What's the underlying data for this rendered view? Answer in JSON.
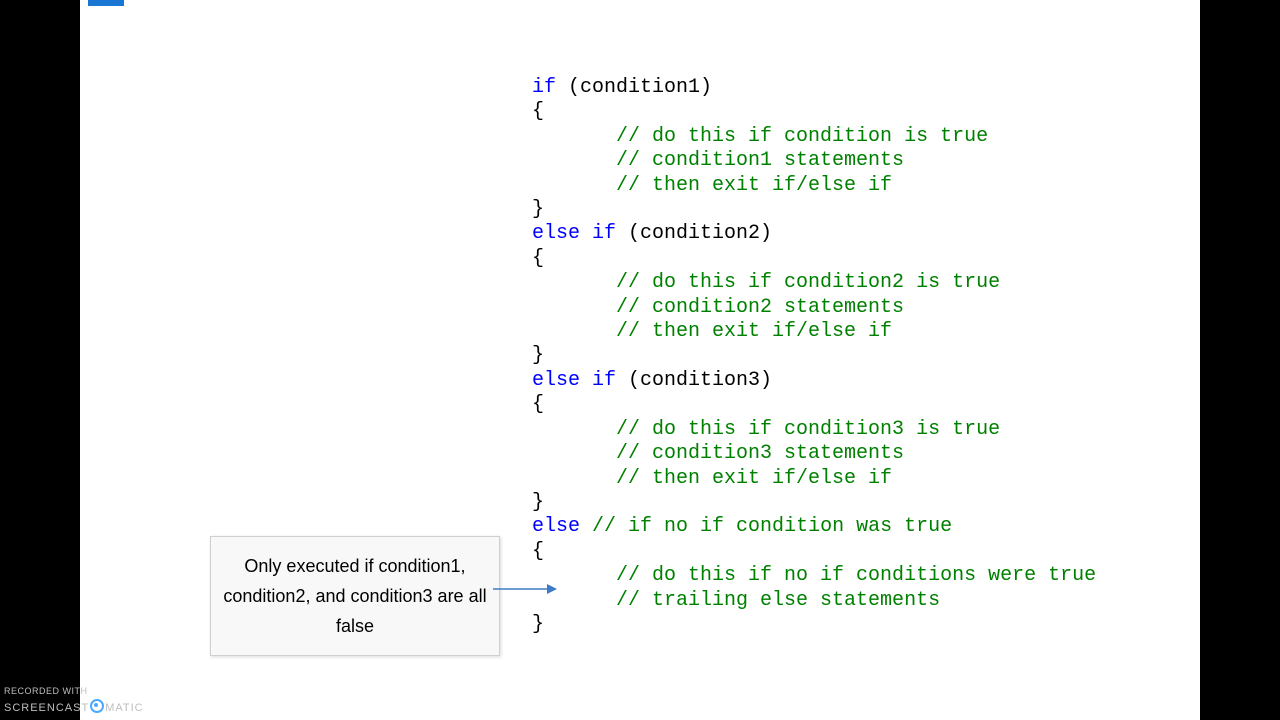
{
  "code": {
    "blocks": [
      {
        "head": [
          {
            "t": "if",
            "c": "kw"
          },
          {
            "t": " (condition1)"
          }
        ],
        "comments": [
          "// do this if condition is true",
          "// condition1 statements",
          "// then exit if/else if"
        ]
      },
      {
        "head": [
          {
            "t": "else if",
            "c": "kw"
          },
          {
            "t": " (condition2)"
          }
        ],
        "comments": [
          "// do this if condition2 is true",
          "// condition2 statements",
          "// then exit if/else if"
        ]
      },
      {
        "head": [
          {
            "t": "else if",
            "c": "kw"
          },
          {
            "t": " (condition3)"
          }
        ],
        "comments": [
          "// do this if condition3 is true",
          "// condition3 statements",
          "// then exit if/else if"
        ]
      },
      {
        "head": [
          {
            "t": "else",
            "c": "kw"
          },
          {
            "t": " "
          },
          {
            "t": "// if no if condition was true",
            "c": "cm"
          }
        ],
        "comments": [
          "// do this if no if conditions were true",
          "// trailing else statements"
        ]
      }
    ],
    "brace_open": "{",
    "brace_close": "}",
    "indent": "       "
  },
  "callout": {
    "text": "Only executed if condition1, condition2, and condition3 are all false"
  },
  "watermark": {
    "line1": "RECORDED WITH",
    "brand_a": "SCREENCAST",
    "brand_b": "MATIC"
  }
}
